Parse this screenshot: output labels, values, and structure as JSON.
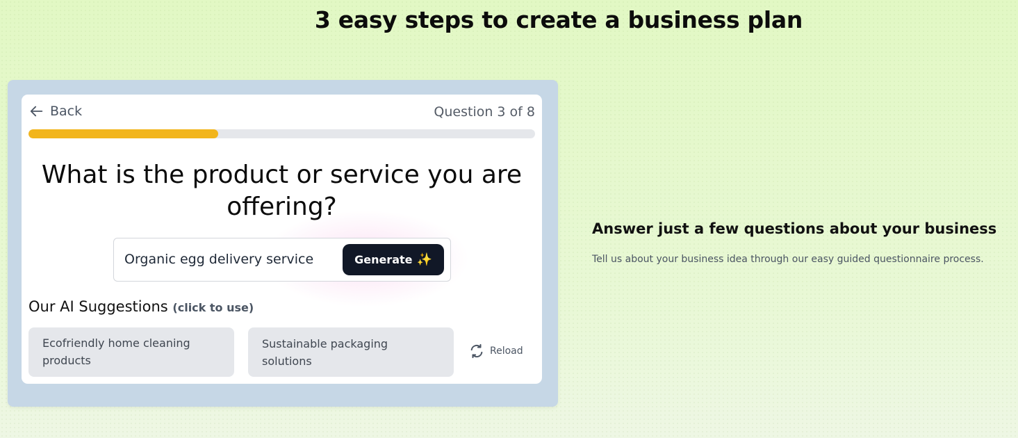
{
  "page": {
    "title": "3 easy steps to create a business plan"
  },
  "questionnaire": {
    "back_label": "Back",
    "question_counter": "Question 3 of 8",
    "progress_fraction": 0.375,
    "question": "What is the product or service you are offering?",
    "answer_value": "Organic egg delivery service",
    "generate_label": "Generate",
    "generate_icon": "✨",
    "suggestions_heading": "Our AI Suggestions",
    "suggestions_hint": "(click to use)",
    "suggestions": [
      "Ecofriendly home cleaning products",
      "Sustainable packaging solutions"
    ],
    "reload_label": "Reload"
  },
  "step": {
    "title": "Answer just a few questions about your business",
    "description": "Tell us about your business idea through our easy guided questionnaire process."
  },
  "colors": {
    "progress": "#f2b51c",
    "button": "#111827",
    "frame": "#c6d7e6",
    "page_bg": "#e4f8c8"
  },
  "icons": {
    "back": "arrow-left-icon",
    "reload": "reload-icon",
    "sparkle": "sparkle-icon"
  }
}
